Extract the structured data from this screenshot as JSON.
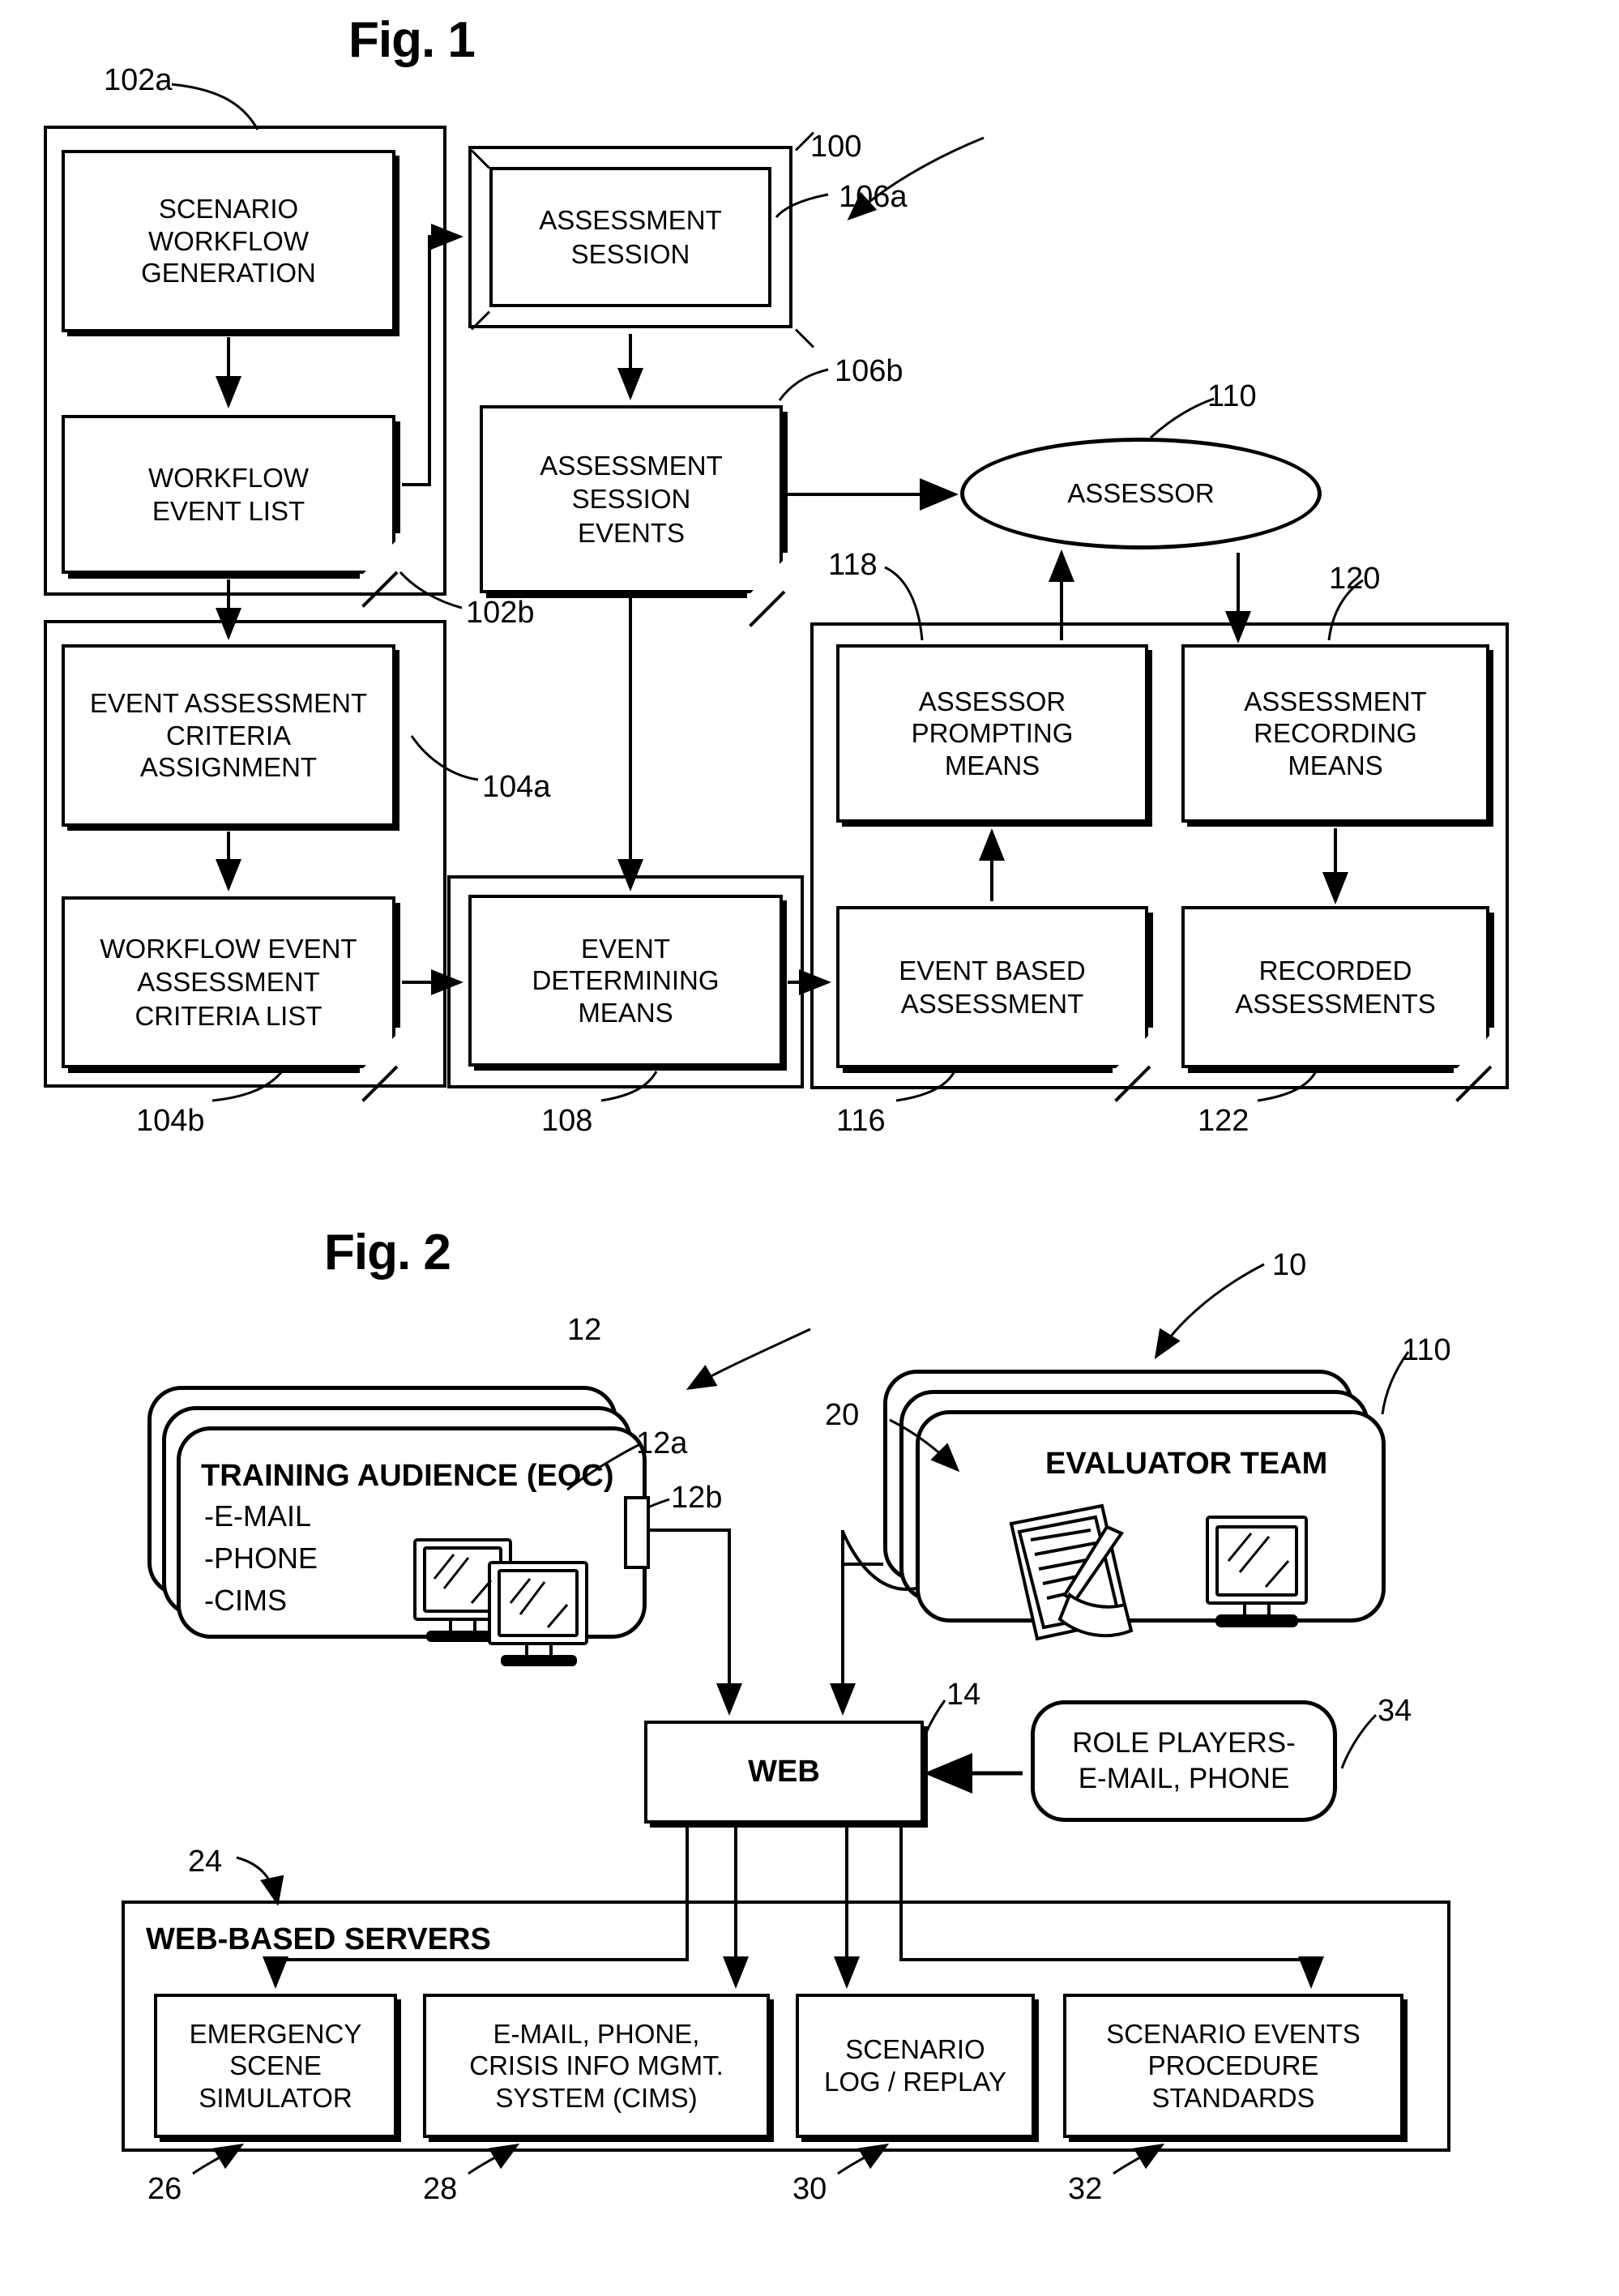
{
  "figures": [
    {
      "id": "fig1",
      "title": "Fig. 1",
      "system_ref": "100",
      "nodes": {
        "scenario_workflow_generation": "SCENARIO\nWORKFLOW\nGENERATION",
        "workflow_event_list": "WORKFLOW\nEVENT LIST",
        "event_assessment_criteria_assignment": "EVENT ASSESSMENT\nCRITERIA\nASSIGNMENT",
        "workflow_event_assessment_criteria_list": "WORKFLOW EVENT\nASSESSMENT\nCRITERIA LIST",
        "assessment_session": "ASSESSMENT\nSESSION",
        "assessment_session_events": "ASSESSMENT\nSESSION\nEVENTS",
        "assessor": "ASSESSOR",
        "event_determining_means": "EVENT\nDETERMINING\nMEANS",
        "assessor_prompting_means": "ASSESSOR\nPROMPTING\nMEANS",
        "assessment_recording_means": "ASSESSMENT\nRECORDING\nMEANS",
        "event_based_assessment": "EVENT BASED\nASSESSMENT",
        "recorded_assessments": "RECORDED\nASSESSMENTS"
      },
      "refs": {
        "r102a": "102a",
        "r102b": "102b",
        "r104a": "104a",
        "r104b": "104b",
        "r106a": "106a",
        "r106b": "106b",
        "r108": "108",
        "r110": "110",
        "r116": "116",
        "r118": "118",
        "r120": "120",
        "r122": "122",
        "r100": "100"
      }
    },
    {
      "id": "fig2",
      "title": "Fig. 2",
      "system_ref": "10",
      "nodes": {
        "training_audience_title": "TRAINING AUDIENCE (EOC)",
        "training_audience_items": [
          "-E-MAIL",
          "-PHONE",
          "-CIMS"
        ],
        "evaluator_team": "EVALUATOR TEAM",
        "web": "WEB",
        "role_players": "ROLE PLAYERS-\nE-MAIL, PHONE",
        "web_based_servers": "WEB-BASED SERVERS",
        "emergency_scene_simulator": "EMERGENCY\nSCENE\nSIMULATOR",
        "cims": "E-MAIL, PHONE,\nCRISIS INFO MGMT.\nSYSTEM (CIMS)",
        "scenario_log_replay": "SCENARIO\nLOG / REPLAY",
        "scenario_events_procedure_standards": "SCENARIO EVENTS\nPROCEDURE\nSTANDARDS"
      },
      "refs": {
        "r10": "10",
        "r12": "12",
        "r12a": "12a",
        "r12b": "12b",
        "r14": "14",
        "r20": "20",
        "r24": "24",
        "r26": "26",
        "r28": "28",
        "r30": "30",
        "r32": "32",
        "r34": "34",
        "r110": "110"
      }
    }
  ],
  "colors": {
    "ink": "#000000",
    "paper": "#ffffff"
  }
}
